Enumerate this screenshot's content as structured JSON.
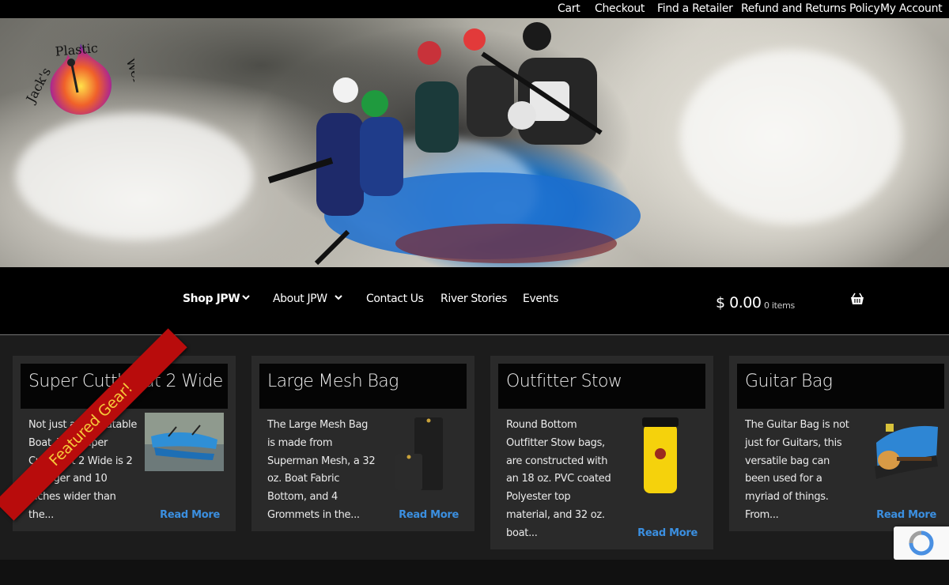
{
  "top_links": [
    "Cart",
    "Checkout",
    "Find a Retailer",
    "Refund and Returns Policy",
    "My Account"
  ],
  "logo": {
    "text": "Jack's Plastic Welding"
  },
  "nav": {
    "items": [
      "Shop JPW",
      "About JPW",
      "Contact Us",
      "River Stories",
      "Events"
    ]
  },
  "cart": {
    "total": "$ 0.00",
    "count": "0 items"
  },
  "ribbon": "Featured Gear!",
  "cards": [
    {
      "title": "Super Cutthroat 2 Wide",
      "desc": "Not just any Inflatable Boat. The Super Cutthroat 2 Wide is 2 ft longer and 10 inches wider than the...",
      "read_more": "Read More"
    },
    {
      "title": "Large Mesh Bag",
      "desc": "The Large Mesh Bag is made from Superman Mesh, a 32 oz. Boat Fabric Bottom, and 4 Grommets in the...",
      "read_more": "Read More"
    },
    {
      "title": "Outfitter Stow",
      "desc": "Round Bottom Outfitter Stow bags, are constructed with an 18 oz. PVC coated Polyester top material, and 32 oz. boat...",
      "read_more": "Read More"
    },
    {
      "title": "Guitar Bag",
      "desc": "The Guitar Bag is not just for Guitars, this versatile bag can been used for a myriad of things. From...",
      "read_more": "Read More"
    }
  ],
  "colors": {
    "accent": "#3b8fe0",
    "ribbon": "#b80c0c",
    "ribbon_text": "#f6c93a"
  }
}
